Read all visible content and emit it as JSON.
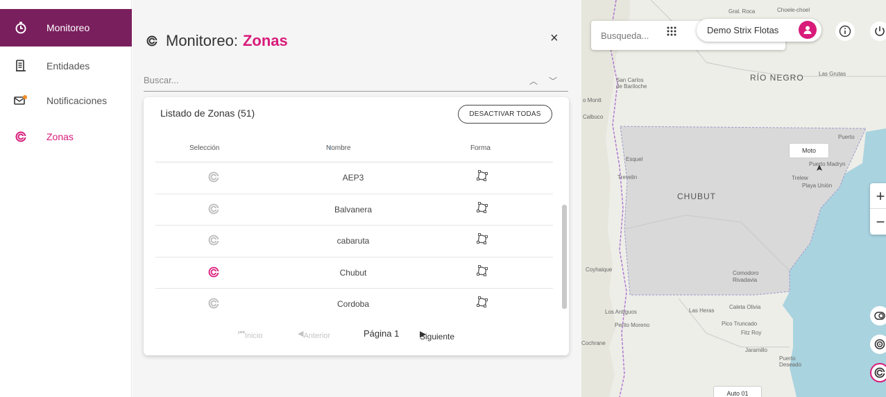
{
  "sidebar": {
    "items": [
      {
        "label": "Monitoreo",
        "icon": "clock-icon"
      },
      {
        "label": "Entidades",
        "icon": "list-icon"
      },
      {
        "label": "Notificaciones",
        "icon": "notification-icon"
      },
      {
        "label": "Zonas",
        "icon": "zone-icon"
      }
    ]
  },
  "panel": {
    "title_prefix": "Monitoreo:",
    "title_accent": "Zonas",
    "close": "×",
    "search_placeholder": "Buscar...",
    "list": {
      "title": "Listado de Zonas (51)",
      "deactivate_label": "DESACTIVAR TODAS",
      "columns": [
        "Selección",
        "Nombre",
        "Forma"
      ],
      "rows": [
        {
          "name": "AEP3",
          "selected": false
        },
        {
          "name": "Balvanera",
          "selected": false
        },
        {
          "name": "cabaruta",
          "selected": false
        },
        {
          "name": "Chubut",
          "selected": true
        },
        {
          "name": "Cordoba",
          "selected": false
        }
      ]
    },
    "pager": {
      "first": "Inicio",
      "prev": "Anterior",
      "current": "Página 1",
      "next": "Siguiente"
    }
  },
  "map": {
    "search_placeholder": "Busqueda...",
    "user_name": "Demo Strix Flotas",
    "zoom_in": "+",
    "zoom_out": "−",
    "markers": [
      "Moto",
      "Auto 01"
    ],
    "labels": {
      "gral_roca": "Gral. Roca",
      "choele": "Choele-choel",
      "rio_negro": "RÍO NEGRO",
      "las_grutas": "Las Grutas",
      "san_carlos": "San Carlos de Bariloche",
      "montt": "o Montt",
      "calbuco": "Calbuco",
      "esquel": "Esquel",
      "trevelin": "Trevelin",
      "chubut": "CHUBUT",
      "trelew": "Trelew",
      "playa_union": "Playa Unión",
      "puerto_madryn": "Puerto Madryn",
      "puerto": "Puerto",
      "coyhaique": "Coyhaique",
      "comodoro": "Comodoro Rivadavia",
      "los_antiguos": "Los Antiguos",
      "perito_moreno": "Perito Moreno",
      "las_heras": "Las Heras",
      "caleta_olivia": "Caleta Olivia",
      "pico_truncado": "Pico Truncado",
      "fitz_roy": "Fitz Roy",
      "jaramillo": "Jaramillo",
      "puerto_deseado": "Puerto Deseado",
      "cochrane": "Cochrane"
    }
  },
  "colors": {
    "accent": "#d81b7a",
    "sidebar_active": "#7a1f5e",
    "zone_fill": "#d9d9d9",
    "sea": "#a9d3df",
    "land": "#eeeee8"
  }
}
